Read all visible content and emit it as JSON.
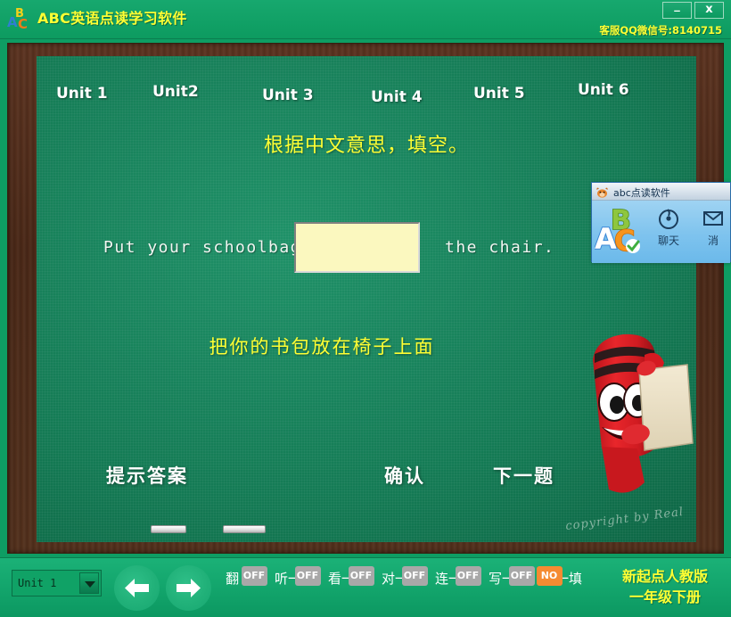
{
  "window": {
    "title": "ABC英语点读学习软件",
    "support_text": "客服QQ微信号:8140715",
    "minimize_label": "_",
    "close_label": "x",
    "logo_icon": "abc-logo-icon"
  },
  "board": {
    "unit_tabs": [
      {
        "label": "Unit 1"
      },
      {
        "label": "Unit2"
      },
      {
        "label": "Unit 3"
      },
      {
        "label": "Unit 4"
      },
      {
        "label": "Unit 5"
      },
      {
        "label": "Unit 6"
      }
    ],
    "instruction": "根据中文意思，填空。",
    "question": {
      "left_text": "Put your schoolbag",
      "right_text": "the chair.",
      "input_value": "",
      "input_placeholder": ""
    },
    "translation": "把你的书包放在椅子上面",
    "buttons": {
      "hint": "提示答案",
      "confirm": "确认",
      "next": "下一题"
    },
    "copyright": "copyright by Real",
    "mascot_icon": "red-crayon-mascot"
  },
  "popup": {
    "title": "abc点读软件",
    "app_icon": "cow-app-icon",
    "logo_icon": "abc-blocks-icon",
    "items": [
      {
        "label": "聊天",
        "icon": "chat-icon"
      },
      {
        "label": "消",
        "icon": "envelope-icon"
      }
    ]
  },
  "toolbar": {
    "unit_select": {
      "value": "Unit 1",
      "arrow_icon": "chevron-down-icon"
    },
    "nav": {
      "prev_icon": "arrow-left-icon",
      "next_icon": "arrow-right-icon"
    },
    "toggles": [
      {
        "label": "翻 译",
        "state": "OFF",
        "active": false
      },
      {
        "label": "听一听",
        "state": "OFF",
        "active": false
      },
      {
        "label": "看一看",
        "state": "OFF",
        "active": false
      },
      {
        "label": "对一对",
        "state": "OFF",
        "active": false
      },
      {
        "label": "连一连",
        "state": "OFF",
        "active": false
      },
      {
        "label": "写一写",
        "state": "OFF",
        "active": false
      },
      {
        "label": "填一填",
        "state": "NO",
        "active": true
      }
    ],
    "edition_line1": "新起点人教版",
    "edition_line2": "一年级下册"
  },
  "colors": {
    "accent_green": "#0e9d63",
    "board_green": "#147a54",
    "frame_brown": "#4a2817",
    "chalk_yellow": "#ffff33",
    "toggle_on_orange": "#f58b32",
    "toggle_off_gray": "#a8a8a8",
    "input_yellow": "#fbf8bf"
  }
}
